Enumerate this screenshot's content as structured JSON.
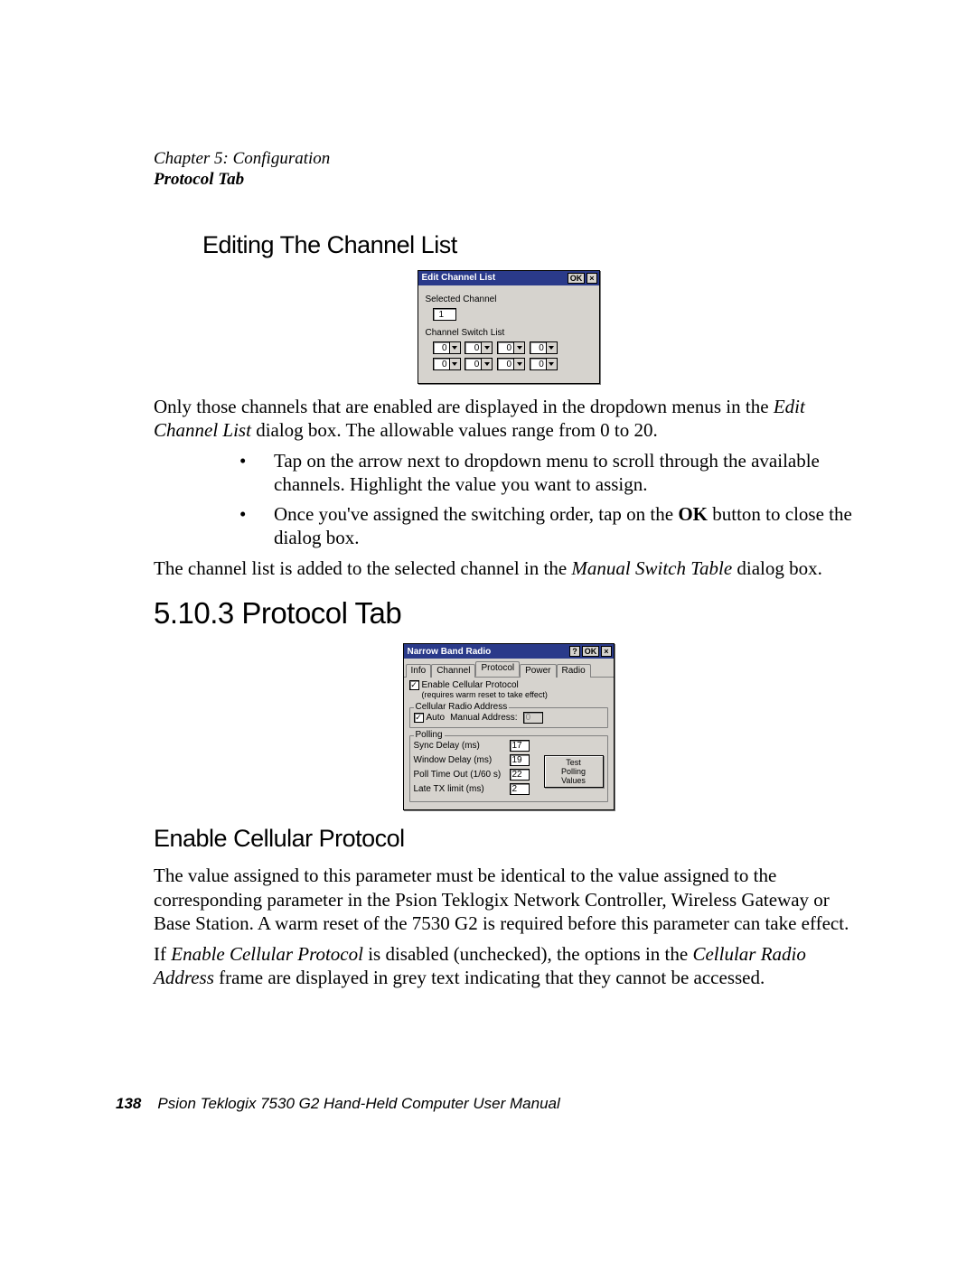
{
  "runhead": {
    "chapter": "Chapter 5: Configuration",
    "section": "Protocol Tab"
  },
  "h_edit_channel": "Editing The Channel List",
  "h_protocol_tab": "5.10.3  Protocol Tab",
  "h_enable_cell": "Enable Cellular Protocol",
  "para1_a": "Only those channels that are enabled are displayed in the dropdown menus in the ",
  "para1_i": "Edit Channel List",
  "para1_b": " dialog box. The allowable values range from 0 to 20.",
  "li1": "Tap on the arrow next to dropdown menu to scroll through the available channels. Highlight the value you want to assign.",
  "li2_a": "Once you've assigned the switching order, tap on the ",
  "li2_b": "OK",
  "li2_c": " button to close the dialog box.",
  "para2_a": "The channel list is added to the selected channel in the ",
  "para2_i": "Manual Switch Table",
  "para2_b": " dialog box.",
  "para3": "The value assigned to this parameter must be identical to the value assigned to the corresponding parameter in the Psion Teklogix Network Controller, Wireless Gateway or Base Station. A warm reset of the 7530 G2 is required before this parameter can take effect.",
  "para4_a": "If ",
  "para4_i1": "Enable Cellular Protocol",
  "para4_b": " is disabled (unchecked), the options in the ",
  "para4_i2": "Cellular Radio Address",
  "para4_c": " frame are displayed in grey text indicating that they cannot be accessed.",
  "footer": {
    "page": "138",
    "text": "Psion Teklogix 7530 G2 Hand-Held Computer User Manual"
  },
  "dlg1": {
    "title": "Edit Channel List",
    "ok": "OK",
    "close": "×",
    "selected_label": "Selected Channel",
    "selected_value": "1",
    "switch_label": "Channel Switch List",
    "cells": [
      "0",
      "0",
      "0",
      "0",
      "0",
      "0",
      "0",
      "0"
    ]
  },
  "dlg2": {
    "title": "Narrow Band Radio",
    "help": "?",
    "ok": "OK",
    "close": "×",
    "tabs": {
      "info": "Info",
      "channel": "Channel",
      "protocol": "Protocol",
      "power": "Power",
      "radio": "Radio"
    },
    "enable_label_l1": "Enable Cellular Protocol",
    "enable_label_l2": "(requires warm reset to take effect)",
    "enable_checked": "✓",
    "cra_legend": "Cellular Radio Address",
    "auto_label": "Auto",
    "auto_checked": "✓",
    "manual_label": "Manual Address:",
    "manual_value": "0",
    "polling_legend": "Polling",
    "rows": {
      "sync": {
        "label": "Sync Delay (ms)",
        "val": "17"
      },
      "window": {
        "label": "Window Delay (ms)",
        "val": "19"
      },
      "poll": {
        "label": "Poll Time Out (1/60 s)",
        "val": "22"
      },
      "late": {
        "label": "Late TX limit (ms)",
        "val": "2"
      }
    },
    "test_btn_l1": "Test",
    "test_btn_l2": "Polling",
    "test_btn_l3": "Values"
  }
}
